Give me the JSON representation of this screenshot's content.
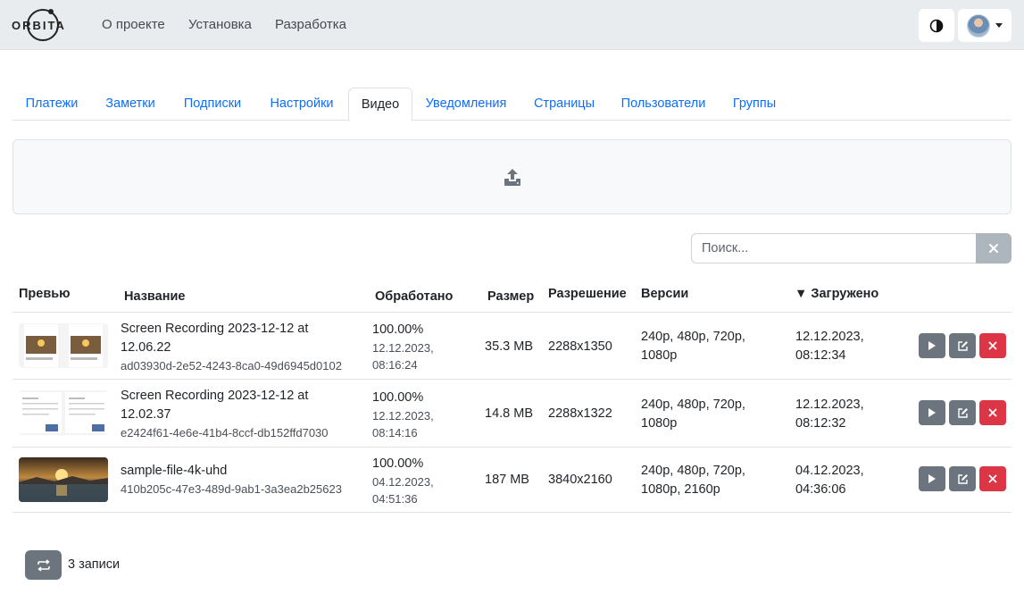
{
  "brand": {
    "logo_text": "ORBITA"
  },
  "nav": {
    "links": [
      "О проекте",
      "Установка",
      "Разработка"
    ],
    "theme_icon": "half-circle-icon",
    "avatar_icon": "user-avatar"
  },
  "tabs": [
    "Платежи",
    "Заметки",
    "Подписки",
    "Настройки",
    "Видео",
    "Уведомления",
    "Страницы",
    "Пользователи",
    "Группы"
  ],
  "active_tab": "Видео",
  "dropzone": {
    "icon": "upload-icon"
  },
  "search": {
    "placeholder": "Поиск...",
    "value": ""
  },
  "table": {
    "headers": {
      "preview": "Превью",
      "name": "Название",
      "processed": "Обработано",
      "size": "Размер",
      "resolution": "Разрешение",
      "versions": "Версии",
      "uploaded": "▼ Загружено"
    },
    "rows": [
      {
        "title_l1": "Screen Recording 2023-12-12 at",
        "title_l2": "12.06.22",
        "uuid": "ad03930d-2e52-4243-8ca0-49d6945d0102",
        "percent": "100.00%",
        "processed_date": "12.12.2023,",
        "processed_time": "08:16:24",
        "size": "35.3 MB",
        "resolution": "2288x1350",
        "versions_l1": "240p, 480p, 720p,",
        "versions_l2": "1080p",
        "uploaded_date": "12.12.2023,",
        "uploaded_time": "08:12:34"
      },
      {
        "title_l1": "Screen Recording 2023-12-12 at",
        "title_l2": "12.02.37",
        "uuid": "e2424f61-4e6e-41b4-8ccf-db152ffd7030",
        "percent": "100.00%",
        "processed_date": "12.12.2023,",
        "processed_time": "08:14:16",
        "size": "14.8 MB",
        "resolution": "2288x1322",
        "versions_l1": "240p, 480p, 720p,",
        "versions_l2": "1080p",
        "uploaded_date": "12.12.2023,",
        "uploaded_time": "08:12:32"
      },
      {
        "title_l1": "sample-file-4k-uhd",
        "title_l2": "",
        "uuid": "410b205c-47e3-489d-9ab1-3a3ea2b25623",
        "percent": "100.00%",
        "processed_date": "04.12.2023,",
        "processed_time": "04:51:36",
        "size": "187 MB",
        "resolution": "3840x2160",
        "versions_l1": "240p, 480p, 720p,",
        "versions_l2": "1080p, 2160p",
        "uploaded_date": "04.12.2023,",
        "uploaded_time": "04:36:06"
      }
    ],
    "actions": {
      "play_icon": "play-icon",
      "edit_icon": "edit-icon",
      "delete_icon": "close-icon"
    }
  },
  "footer": {
    "refresh_icon": "refresh-icon",
    "count": "3 записи"
  },
  "colors": {
    "link": "#0d6efd",
    "secondary": "#6c757d",
    "danger": "#dc3545",
    "navbar_bg": "#e9ecef"
  }
}
